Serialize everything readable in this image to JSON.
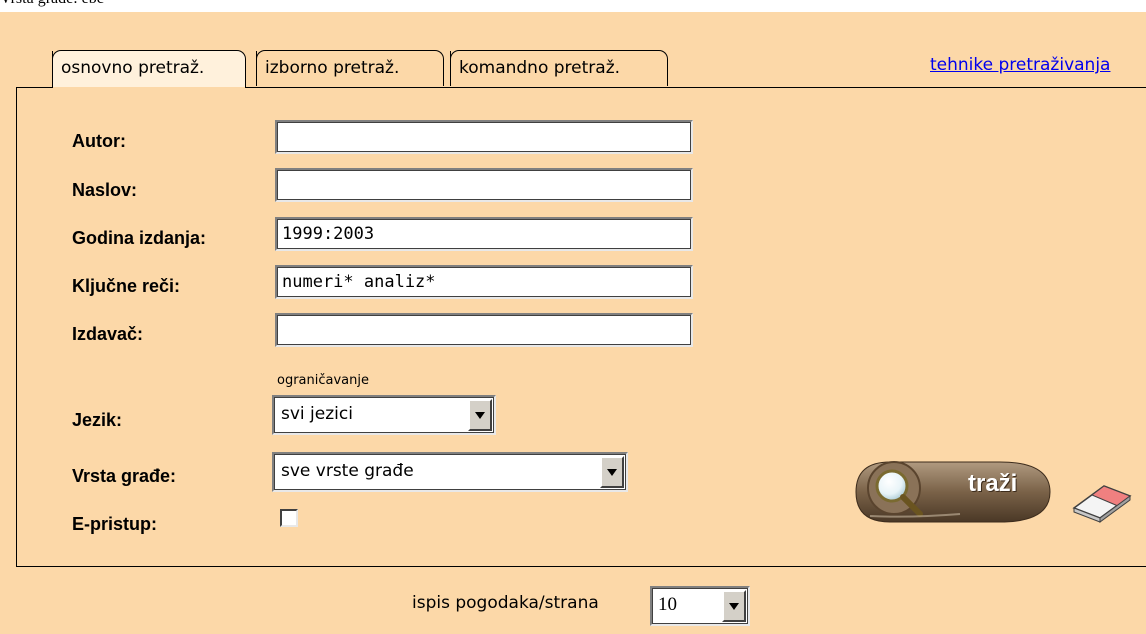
{
  "top_caption": "Vrsta građe: ebc",
  "tabs": [
    {
      "label": "osnovno pretraž.",
      "active": true
    },
    {
      "label": "izborno pretraž.",
      "active": false
    },
    {
      "label": "komandno pretraž.",
      "active": false
    }
  ],
  "help_link": "tehnike pretraživanja",
  "form": {
    "author_label": "Autor:",
    "author_value": "",
    "title_label": "Naslov:",
    "title_value": "",
    "year_label": "Godina izdanja:",
    "year_value": "1999:2003",
    "keywords_label": "Ključne reči:",
    "keywords_value": "numeri* analiz*",
    "publisher_label": "Izdavač:",
    "publisher_value": "",
    "restriction_note": "ograničavanje",
    "language_label": "Jezik:",
    "language_value": "svi jezici",
    "material_label": "Vrsta građe:",
    "material_value": "sve vrste građe",
    "eaccess_label": "E-pristup:",
    "eaccess_checked": false
  },
  "search_button": "traži",
  "results_per_page": {
    "label": "ispis pogodaka/strana",
    "value": "10"
  },
  "colors": {
    "background": "#fcd8a8",
    "active_tab": "#fff1dc",
    "link": "#0000ee"
  }
}
